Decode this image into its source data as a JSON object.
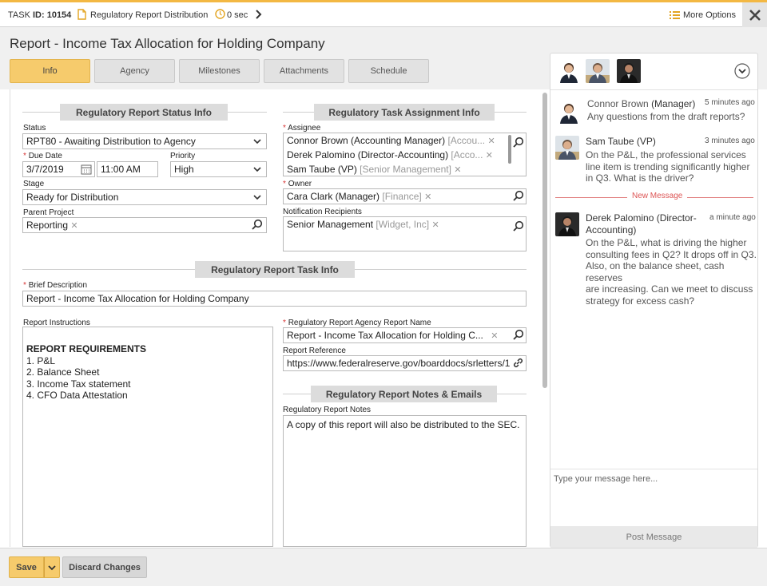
{
  "topbar": {
    "task_prefix": "TASK",
    "task_id": "ID: 10154",
    "doc_title": "Regulatory Report Distribution",
    "timer": "0 sec",
    "more_options": "More Options"
  },
  "page_title": "Report - Income Tax Allocation for Holding Company",
  "tabs": [
    {
      "label": "Info"
    },
    {
      "label": "Agency"
    },
    {
      "label": "Milestones"
    },
    {
      "label": "Attachments"
    },
    {
      "label": "Schedule"
    }
  ],
  "status_section": {
    "header": "Regulatory Report Status Info",
    "status_label": "Status",
    "status_value": "RPT80 - Awaiting Distribution to Agency",
    "due_label": "Due Date",
    "due_date": "3/7/2019",
    "due_time": "11:00 AM",
    "priority_label": "Priority",
    "priority_value": "High",
    "stage_label": "Stage",
    "stage_value": "Ready for Distribution",
    "parent_label": "Parent Project",
    "parent_value": "Reporting"
  },
  "assignment_section": {
    "header": "Regulatory Task Assignment Info",
    "assignee_label": "Assignee",
    "assignees": [
      {
        "name": "Connor Brown (Accounting Manager)",
        "tag": "[Accou..."
      },
      {
        "name": "Derek Palomino (Director-Accounting)",
        "tag": "[Acco..."
      },
      {
        "name": "Sam Taube (VP)",
        "tag": "[Senior Management]"
      }
    ],
    "owner_label": "Owner",
    "owner_name": "Cara  Clark (Manager)",
    "owner_tag": "[Finance]",
    "notif_label": "Notification Recipients",
    "notif_name": "Senior Management",
    "notif_tag": "[Widget, Inc]"
  },
  "task_section": {
    "header": "Regulatory Report Task Info",
    "brief_label": "Brief Description",
    "brief_value": "Report - Income Tax Allocation for Holding Company",
    "instr_label": "Report Instructions",
    "instr_heading": "REPORT REQUIREMENTS",
    "instr_items": [
      "1. P&L",
      "2. Balance Sheet",
      "3. Income Tax statement",
      "4. CFO Data Attestation"
    ],
    "agency_name_label": "Regulatory Report Agency Report Name",
    "agency_name_value": "Report - Income Tax Allocation for Holding C...",
    "reference_label": "Report Reference",
    "reference_value": "https://www.federalreserve.gov/boarddocs/srletters/1"
  },
  "notes_section": {
    "header": "Regulatory Report Notes & Emails",
    "notes_label": "Regulatory Report Notes",
    "notes_value": "A copy of this report will also be distributed to the SEC."
  },
  "chat": {
    "messages": [
      {
        "name": "Connor Brown",
        "role": "(Manager)",
        "time": "5 minutes ago",
        "text": "Any questions from the draft reports?"
      },
      {
        "name": "Sam Taube (VP)",
        "time": "3 minutes ago",
        "text": [
          "On the P&L, the professional services",
          "line item is trending significantly higher",
          "in Q3. What is the driver?"
        ]
      },
      {
        "name": "Derek Palomino (Director-",
        "name2": "Accounting)",
        "time": "a minute ago",
        "text": [
          "On the P&L, what is driving the higher",
          "consulting fees in Q2? It drops off in Q3.",
          "Also, on the balance sheet, cash reserves",
          "are increasing. Can we meet to discuss",
          "strategy for excess cash?"
        ]
      }
    ],
    "new_message": "New Message",
    "placeholder": "Type your message here...",
    "post_label": "Post Message"
  },
  "footer": {
    "save_label": "Save",
    "discard_label": "Discard Changes"
  },
  "colors": {
    "accent": "#f6cb6c",
    "top_border": "#f3b843",
    "required": "#d63333"
  }
}
